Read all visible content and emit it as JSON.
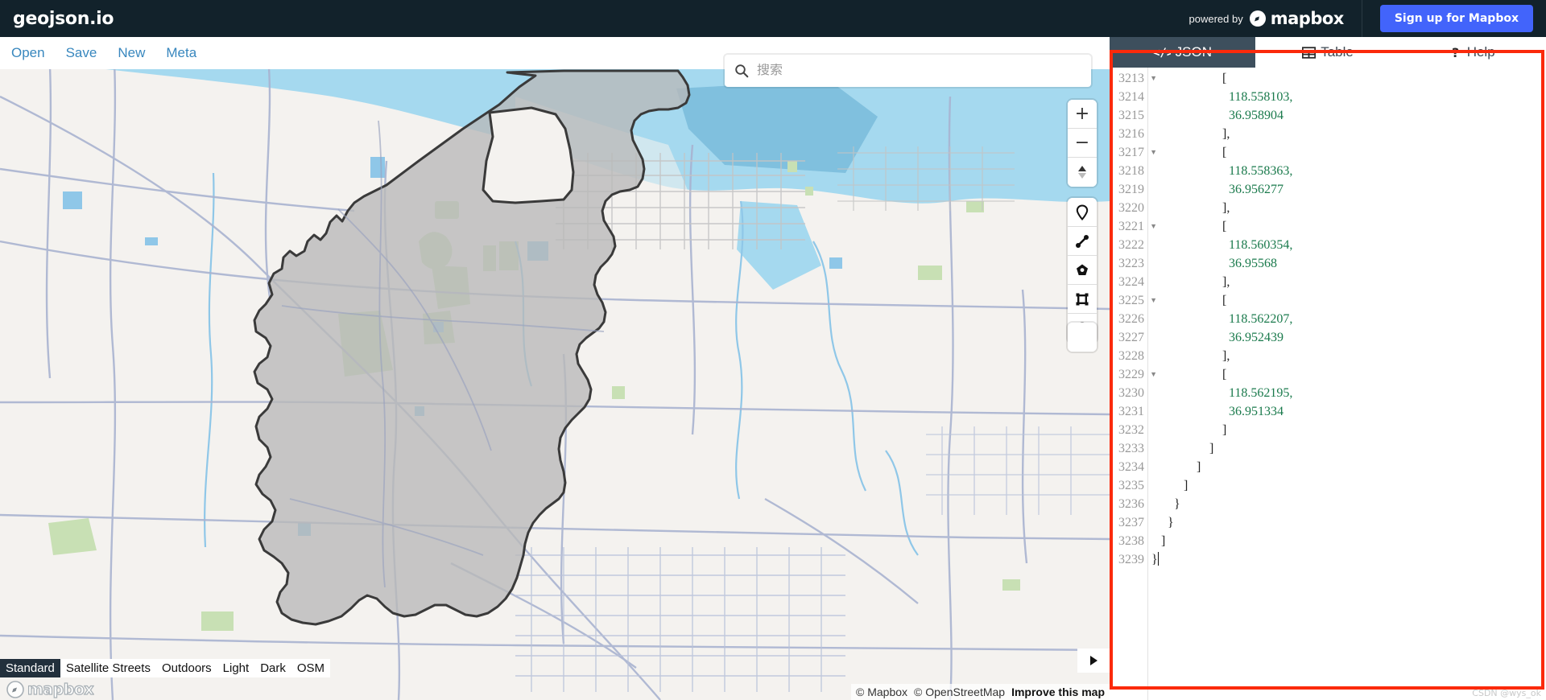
{
  "header": {
    "brand": "geojson.io",
    "powered_by_label": "powered by",
    "mapbox_wordmark": "mapbox",
    "signup_label": "Sign up for Mapbox",
    "brand_bg": "#12222b",
    "signup_color": "#4264fb"
  },
  "nav": {
    "items": [
      {
        "label": "Open",
        "name": "nav-open"
      },
      {
        "label": "Save",
        "name": "nav-save"
      },
      {
        "label": "New",
        "name": "nav-new"
      },
      {
        "label": "Meta",
        "name": "nav-meta"
      }
    ],
    "link_color": "#3887be"
  },
  "search": {
    "placeholder": "搜索",
    "value": "",
    "icon": "search-icon"
  },
  "map_controls": {
    "zoom_in": "+",
    "zoom_out": "−",
    "compass": "compass-icon",
    "draw_point": "marker-pin-icon",
    "draw_line": "line-string-icon",
    "draw_polygon": "polygon-icon",
    "draw_rectangle": "rectangle-icon",
    "draw_circle": "circle-icon",
    "extra": "blank-square-icon",
    "collapse": "chevron-right-icon"
  },
  "map_styles": {
    "active": "Standard",
    "items": [
      "Standard",
      "Satellite Streets",
      "Outdoors",
      "Light",
      "Dark",
      "OSM"
    ]
  },
  "map_footer": {
    "logo_text": "mapbox",
    "attribution_mapbox": "© Mapbox",
    "attribution_osm": "© OpenStreetMap",
    "improve_link": "Improve this map"
  },
  "panel": {
    "tabs": [
      {
        "label": "JSON",
        "icon": "code-brackets-icon",
        "active": true
      },
      {
        "label": "Table",
        "icon": "table-grid-icon",
        "active": false
      },
      {
        "label": "Help",
        "icon": "question-mark-icon",
        "active": false
      }
    ],
    "first_line_number": 3213,
    "code_color_number": "#1a7a4c",
    "lines": [
      {
        "n": 3213,
        "fold": true,
        "indent": 22,
        "text": "[",
        "type": "bracket"
      },
      {
        "n": 3214,
        "fold": false,
        "indent": 24,
        "text": "118.558103,",
        "type": "number"
      },
      {
        "n": 3215,
        "fold": false,
        "indent": 24,
        "text": "36.958904",
        "type": "number"
      },
      {
        "n": 3216,
        "fold": false,
        "indent": 22,
        "text": "],",
        "type": "bracket"
      },
      {
        "n": 3217,
        "fold": true,
        "indent": 22,
        "text": "[",
        "type": "bracket"
      },
      {
        "n": 3218,
        "fold": false,
        "indent": 24,
        "text": "118.558363,",
        "type": "number"
      },
      {
        "n": 3219,
        "fold": false,
        "indent": 24,
        "text": "36.956277",
        "type": "number"
      },
      {
        "n": 3220,
        "fold": false,
        "indent": 22,
        "text": "],",
        "type": "bracket"
      },
      {
        "n": 3221,
        "fold": true,
        "indent": 22,
        "text": "[",
        "type": "bracket"
      },
      {
        "n": 3222,
        "fold": false,
        "indent": 24,
        "text": "118.560354,",
        "type": "number"
      },
      {
        "n": 3223,
        "fold": false,
        "indent": 24,
        "text": "36.95568",
        "type": "number"
      },
      {
        "n": 3224,
        "fold": false,
        "indent": 22,
        "text": "],",
        "type": "bracket"
      },
      {
        "n": 3225,
        "fold": true,
        "indent": 22,
        "text": "[",
        "type": "bracket"
      },
      {
        "n": 3226,
        "fold": false,
        "indent": 24,
        "text": "118.562207,",
        "type": "number"
      },
      {
        "n": 3227,
        "fold": false,
        "indent": 24,
        "text": "36.952439",
        "type": "number"
      },
      {
        "n": 3228,
        "fold": false,
        "indent": 22,
        "text": "],",
        "type": "bracket"
      },
      {
        "n": 3229,
        "fold": true,
        "indent": 22,
        "text": "[",
        "type": "bracket"
      },
      {
        "n": 3230,
        "fold": false,
        "indent": 24,
        "text": "118.562195,",
        "type": "number"
      },
      {
        "n": 3231,
        "fold": false,
        "indent": 24,
        "text": "36.951334",
        "type": "number"
      },
      {
        "n": 3232,
        "fold": false,
        "indent": 22,
        "text": "]",
        "type": "bracket"
      },
      {
        "n": 3233,
        "fold": false,
        "indent": 18,
        "text": "]",
        "type": "bracket"
      },
      {
        "n": 3234,
        "fold": false,
        "indent": 14,
        "text": "]",
        "type": "bracket"
      },
      {
        "n": 3235,
        "fold": false,
        "indent": 10,
        "text": "]",
        "type": "bracket"
      },
      {
        "n": 3236,
        "fold": false,
        "indent": 7,
        "text": "}",
        "type": "bracket"
      },
      {
        "n": 3237,
        "fold": false,
        "indent": 5,
        "text": "}",
        "type": "bracket"
      },
      {
        "n": 3238,
        "fold": false,
        "indent": 3,
        "text": "]",
        "type": "bracket"
      },
      {
        "n": 3239,
        "fold": false,
        "indent": 0,
        "text": "}",
        "type": "bracket",
        "caret": true
      }
    ]
  },
  "annotation": {
    "highlight_color": "#fb2a0b",
    "watermark": "CSDN @wys_ok"
  }
}
